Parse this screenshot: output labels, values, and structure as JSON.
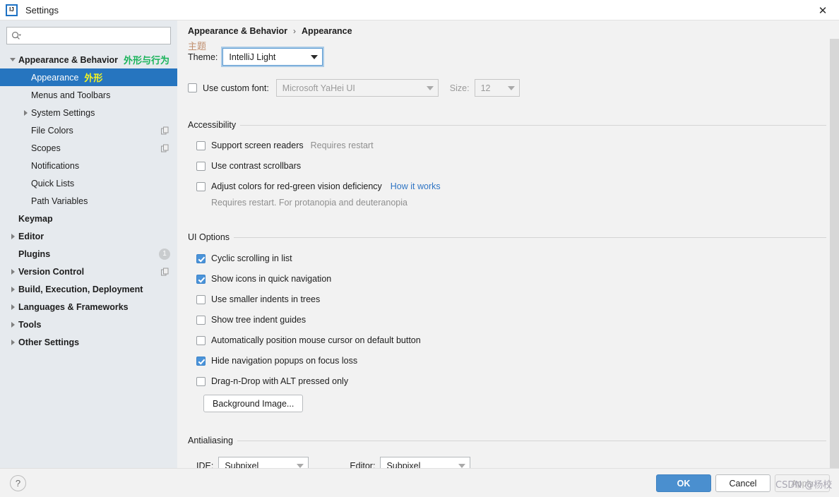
{
  "window": {
    "title": "Settings",
    "logo_icon": "intellij-idea-icon",
    "close_icon": "close-icon"
  },
  "sidebar": {
    "search": {
      "placeholder": "",
      "value": "",
      "icon": "search-icon"
    },
    "items": [
      {
        "label": "Appearance & Behavior",
        "cn": "外形与行为",
        "cn_color": "green",
        "bold": true,
        "indent": 0,
        "arrow": "down",
        "selected": false,
        "trailing": ""
      },
      {
        "label": "Appearance",
        "cn": "外形",
        "cn_color": "yellow",
        "bold": false,
        "indent": 1,
        "arrow": "none",
        "selected": true,
        "trailing": ""
      },
      {
        "label": "Menus and Toolbars",
        "cn": "",
        "cn_color": "",
        "bold": false,
        "indent": 1,
        "arrow": "none",
        "selected": false,
        "trailing": ""
      },
      {
        "label": "System Settings",
        "cn": "",
        "cn_color": "",
        "bold": false,
        "indent": 1,
        "arrow": "right",
        "selected": false,
        "trailing": ""
      },
      {
        "label": "File Colors",
        "cn": "",
        "cn_color": "",
        "bold": false,
        "indent": 1,
        "arrow": "none",
        "selected": false,
        "trailing": "copy"
      },
      {
        "label": "Scopes",
        "cn": "",
        "cn_color": "",
        "bold": false,
        "indent": 1,
        "arrow": "none",
        "selected": false,
        "trailing": "copy"
      },
      {
        "label": "Notifications",
        "cn": "",
        "cn_color": "",
        "bold": false,
        "indent": 1,
        "arrow": "none",
        "selected": false,
        "trailing": ""
      },
      {
        "label": "Quick Lists",
        "cn": "",
        "cn_color": "",
        "bold": false,
        "indent": 1,
        "arrow": "none",
        "selected": false,
        "trailing": ""
      },
      {
        "label": "Path Variables",
        "cn": "",
        "cn_color": "",
        "bold": false,
        "indent": 1,
        "arrow": "none",
        "selected": false,
        "trailing": ""
      },
      {
        "label": "Keymap",
        "cn": "",
        "cn_color": "",
        "bold": true,
        "indent": 0,
        "arrow": "none",
        "selected": false,
        "trailing": ""
      },
      {
        "label": "Editor",
        "cn": "",
        "cn_color": "",
        "bold": true,
        "indent": 0,
        "arrow": "right",
        "selected": false,
        "trailing": ""
      },
      {
        "label": "Plugins",
        "cn": "",
        "cn_color": "",
        "bold": true,
        "indent": 0,
        "arrow": "none",
        "selected": false,
        "trailing": "badge",
        "badge": "1"
      },
      {
        "label": "Version Control",
        "cn": "",
        "cn_color": "",
        "bold": true,
        "indent": 0,
        "arrow": "right",
        "selected": false,
        "trailing": "copy"
      },
      {
        "label": "Build, Execution, Deployment",
        "cn": "",
        "cn_color": "",
        "bold": true,
        "indent": 0,
        "arrow": "right",
        "selected": false,
        "trailing": ""
      },
      {
        "label": "Languages & Frameworks",
        "cn": "",
        "cn_color": "",
        "bold": true,
        "indent": 0,
        "arrow": "right",
        "selected": false,
        "trailing": ""
      },
      {
        "label": "Tools",
        "cn": "",
        "cn_color": "",
        "bold": true,
        "indent": 0,
        "arrow": "right",
        "selected": false,
        "trailing": ""
      },
      {
        "label": "Other Settings",
        "cn": "",
        "cn_color": "",
        "bold": true,
        "indent": 0,
        "arrow": "right",
        "selected": false,
        "trailing": ""
      }
    ]
  },
  "content": {
    "breadcrumb": {
      "parent": "Appearance & Behavior",
      "separator": "›",
      "current": "Appearance"
    },
    "theme": {
      "annotation": "主题",
      "label": "Theme:",
      "value": "IntelliJ Light"
    },
    "custom_font": {
      "checkbox_label": "Use custom font:",
      "checked": false,
      "font_value": "Microsoft YaHei UI",
      "size_label": "Size:",
      "size_value": "12"
    },
    "accessibility": {
      "title": "Accessibility",
      "options": [
        {
          "label": "Support screen readers",
          "checked": false,
          "hint": "Requires restart",
          "link": ""
        },
        {
          "label": "Use contrast scrollbars",
          "checked": false,
          "hint": "",
          "link": ""
        },
        {
          "label": "Adjust colors for red-green vision deficiency",
          "checked": false,
          "hint": "",
          "link": "How it works"
        }
      ],
      "footnote": "Requires restart. For protanopia and deuteranopia"
    },
    "ui_options": {
      "title": "UI Options",
      "options": [
        {
          "label": "Cyclic scrolling in list",
          "checked": true
        },
        {
          "label": "Show icons in quick navigation",
          "checked": true
        },
        {
          "label": "Use smaller indents in trees",
          "checked": false
        },
        {
          "label": "Show tree indent guides",
          "checked": false
        },
        {
          "label": "Automatically position mouse cursor on default button",
          "checked": false
        },
        {
          "label": "Hide navigation popups on focus loss",
          "checked": true
        },
        {
          "label": "Drag-n-Drop with ALT pressed only",
          "checked": false
        }
      ],
      "background_image_button": "Background Image..."
    },
    "antialiasing": {
      "title": "Antialiasing",
      "ide_label": "IDE:",
      "ide_value": "Subpixel",
      "editor_label": "Editor:",
      "editor_value": "Subpixel"
    }
  },
  "footer": {
    "help_icon": "question-mark-icon",
    "ok": "OK",
    "cancel": "Cancel",
    "apply": "Apply",
    "watermark": "CSDN @杨校"
  }
}
